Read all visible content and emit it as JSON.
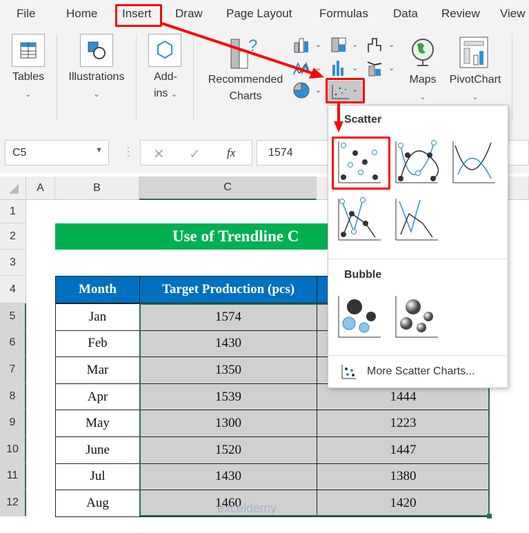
{
  "ribbon": {
    "tabs": [
      "File",
      "Home",
      "Insert",
      "Draw",
      "Page Layout",
      "Formulas",
      "Data",
      "Review",
      "View"
    ],
    "active_tab": "Insert",
    "groups": {
      "tables": "Tables",
      "illustrations": "Illustrations",
      "addins_1": "Add-",
      "addins_2": "ins",
      "recommended_1": "Recommended",
      "recommended_2": "Charts",
      "maps": "Maps",
      "pivotchart": "PivotChart"
    }
  },
  "formula_bar": {
    "name_box": "C5",
    "fx": "fx",
    "value": "1574"
  },
  "columns": [
    "A",
    "B",
    "C"
  ],
  "rows": [
    "1",
    "2",
    "3",
    "4",
    "5",
    "6",
    "7",
    "8",
    "9",
    "10",
    "11",
    "12"
  ],
  "sheet": {
    "title": "Use of Trendline C",
    "headers": [
      "Month",
      "Target Production (pcs)"
    ],
    "data": [
      [
        "Jan",
        "1574",
        ""
      ],
      [
        "Feb",
        "1430",
        ""
      ],
      [
        "Mar",
        "1350",
        ""
      ],
      [
        "Apr",
        "1539",
        "1444"
      ],
      [
        "May",
        "1300",
        "1223"
      ],
      [
        "June",
        "1520",
        "1447"
      ],
      [
        "Jul",
        "1430",
        "1380"
      ],
      [
        "Aug",
        "1460",
        "1420"
      ]
    ]
  },
  "menu": {
    "scatter_heading": "Scatter",
    "bubble_heading": "Bubble",
    "more": "More Scatter Charts..."
  },
  "watermark": "exceldemy",
  "colors": {
    "accent_red": "#ff0000",
    "header_blue": "#0070c0",
    "title_green": "#00b050",
    "chart_blue": "#2e8fd6"
  }
}
